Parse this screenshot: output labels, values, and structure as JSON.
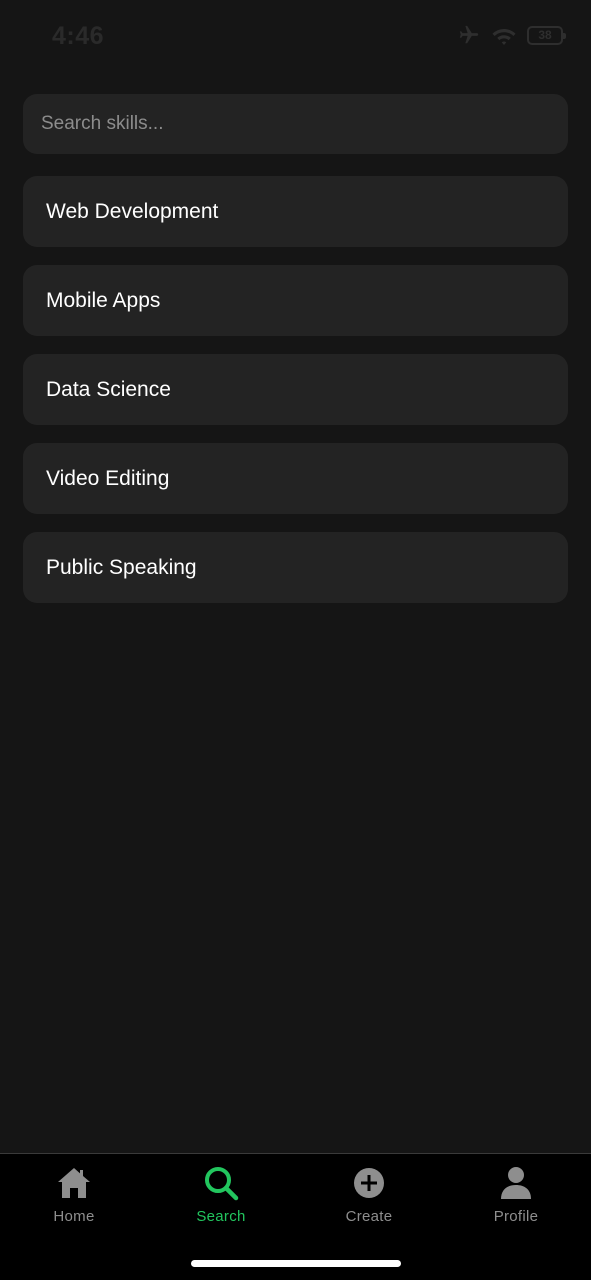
{
  "status_bar": {
    "time": "4:46",
    "battery": "38",
    "icons": [
      "airplane-icon",
      "wifi-icon",
      "battery-icon"
    ]
  },
  "search": {
    "placeholder": "Search skills...",
    "value": ""
  },
  "skills": [
    {
      "label": "Web Development"
    },
    {
      "label": "Mobile Apps"
    },
    {
      "label": "Data Science"
    },
    {
      "label": "Video Editing"
    },
    {
      "label": "Public Speaking"
    }
  ],
  "tab_bar": {
    "active_color": "#22c55e",
    "inactive_color": "#8e8e8e",
    "tabs": [
      {
        "label": "Home",
        "icon": "home-icon"
      },
      {
        "label": "Search",
        "icon": "search-icon",
        "active": true
      },
      {
        "label": "Create",
        "icon": "plus-circle-icon"
      },
      {
        "label": "Profile",
        "icon": "person-icon"
      }
    ]
  }
}
